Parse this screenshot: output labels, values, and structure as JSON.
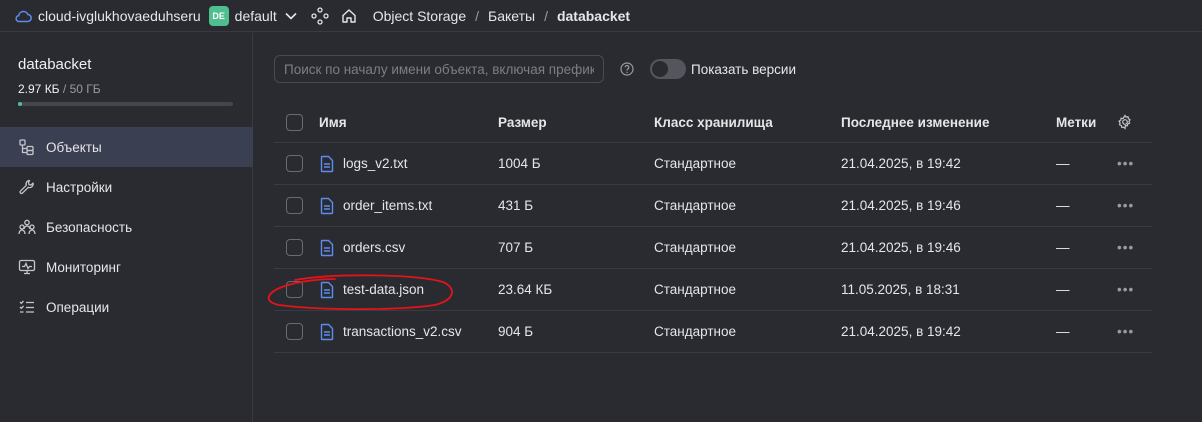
{
  "topbar": {
    "cloud_name": "cloud-ivglukhovaeduhseru",
    "folder_badge": "DE",
    "folder_name": "default",
    "breadcrumbs": [
      "Object Storage",
      "Бакеты",
      "databacket"
    ],
    "separator": "/"
  },
  "sidebar": {
    "bucket_name": "databacket",
    "usage_used": "2.97 КБ",
    "usage_total": " / 50 ГБ",
    "usage_fraction": 6e-08,
    "items": [
      {
        "label": "Объекты",
        "icon": "objects-icon",
        "active": true
      },
      {
        "label": "Настройки",
        "icon": "wrench-icon",
        "active": false
      },
      {
        "label": "Безопасность",
        "icon": "users-icon",
        "active": false
      },
      {
        "label": "Мониторинг",
        "icon": "monitor-icon",
        "active": false
      },
      {
        "label": "Операции",
        "icon": "list-icon",
        "active": false
      }
    ]
  },
  "toolbar": {
    "search_placeholder": "Поиск по началу имени объекта, включая префикс",
    "show_versions_label": "Показать версии",
    "show_versions_on": false
  },
  "table": {
    "columns": {
      "name": "Имя",
      "size": "Размер",
      "storage_class": "Класс хранилища",
      "modified": "Последнее изменение",
      "tags": "Метки"
    },
    "rows": [
      {
        "name": "logs_v2.txt",
        "size": "1004 Б",
        "storage_class": "Стандартное",
        "modified": "21.04.2025, в 19:42",
        "tags": "—",
        "more": "•••"
      },
      {
        "name": "order_items.txt",
        "size": "431 Б",
        "storage_class": "Стандартное",
        "modified": "21.04.2025, в 19:46",
        "tags": "—",
        "more": "•••"
      },
      {
        "name": "orders.csv",
        "size": "707 Б",
        "storage_class": "Стандартное",
        "modified": "21.04.2025, в 19:46",
        "tags": "—",
        "more": "•••"
      },
      {
        "name": "test-data.json",
        "size": "23.64 КБ",
        "storage_class": "Стандартное",
        "modified": "11.05.2025, в 18:31",
        "tags": "—",
        "more": "•••"
      },
      {
        "name": "transactions_v2.csv",
        "size": "904 Б",
        "storage_class": "Стандартное",
        "modified": "21.04.2025, в 19:42",
        "tags": "—",
        "more": "•••"
      }
    ]
  },
  "colors": {
    "background": "#2a2b30",
    "accent_green": "#4fbf8f",
    "file_icon_blue": "#5b8def",
    "active_nav": "#3a3f52",
    "annotation_red": "#e0141b"
  }
}
